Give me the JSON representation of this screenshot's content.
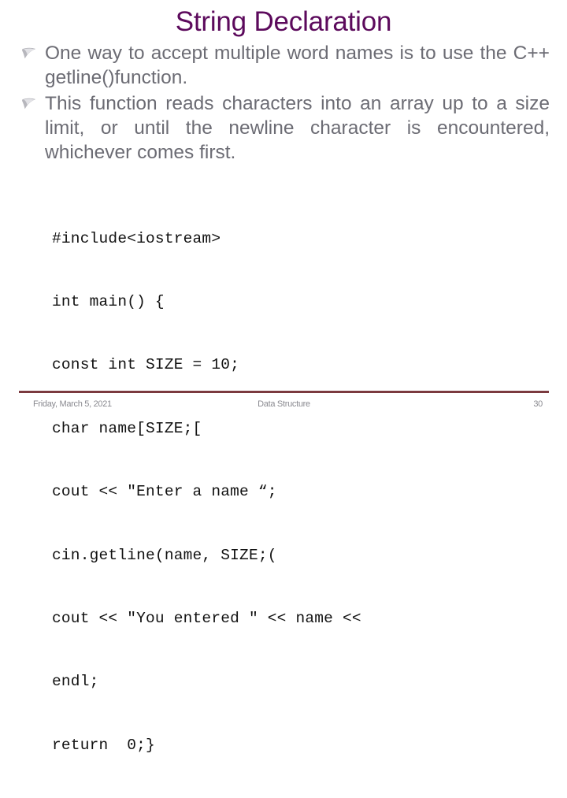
{
  "slide": {
    "title": "String Declaration",
    "title_color": "#5c0a5c",
    "background_color": "#ffffff",
    "body_text_color": "#6c6c74",
    "bullets": [
      {
        "marker": "comma-bullet-icon",
        "text": "One way to accept multiple word names is to use the C++ getline()function."
      },
      {
        "marker": "comma-bullet-icon",
        "text": "This function reads characters into an array up to a size limit, or until the newline character is encountered, whichever comes first."
      }
    ],
    "code": {
      "lines": [
        "#include<iostream>",
        "int main() {",
        "const int SIZE = 10;",
        "char name[SIZE;[",
        "cout << \"Enter a name “;",
        "cin.getline(name, SIZE;(",
        "cout << \"You entered \" << name <<",
        "endl;",
        "return  0;}"
      ]
    }
  },
  "footer": {
    "date": "Friday, March 5, 2021",
    "center": "Data Structure",
    "page_number": "30",
    "rule_color": "#7b3a3f"
  }
}
